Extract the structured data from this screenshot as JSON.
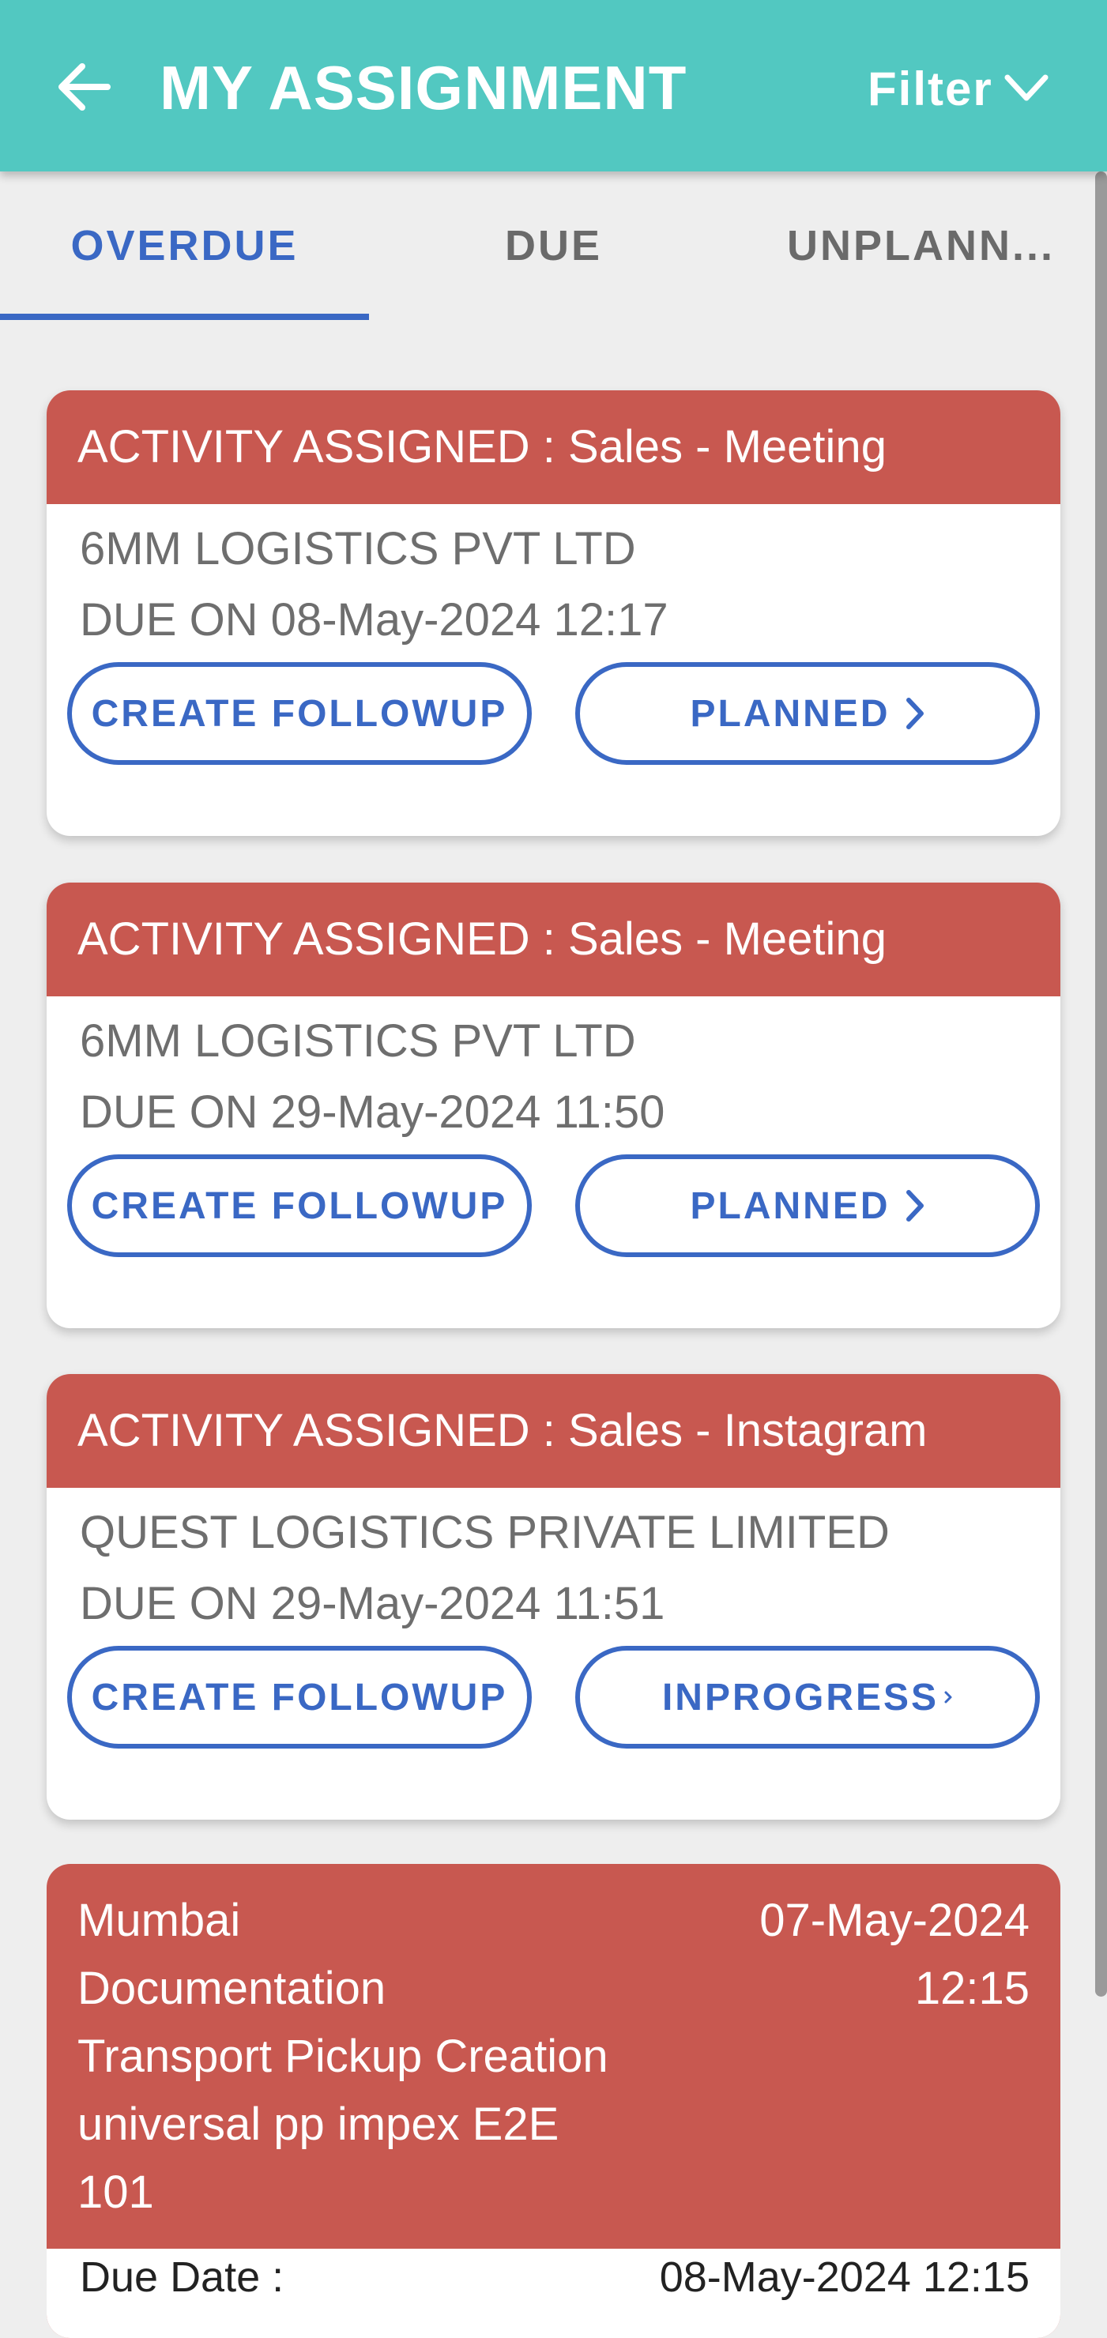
{
  "header": {
    "title": "MY ASSIGNMENT",
    "filter_label": "Filter"
  },
  "tabs": [
    {
      "label": "OVERDUE",
      "active": true
    },
    {
      "label": "DUE",
      "active": false
    },
    {
      "label": "UNPLANN...",
      "active": false
    }
  ],
  "cards": [
    {
      "title": "ACTIVITY ASSIGNED : Sales - Meeting",
      "company": "6MM LOGISTICS PVT LTD",
      "due": "DUE ON 08-May-2024 12:17",
      "left_button": "CREATE FOLLOWUP",
      "right_button": "PLANNED"
    },
    {
      "title": "ACTIVITY ASSIGNED : Sales - Meeting",
      "company": "6MM LOGISTICS PVT LTD",
      "due": "DUE ON 29-May-2024 11:50",
      "left_button": "CREATE FOLLOWUP",
      "right_button": "PLANNED"
    },
    {
      "title": "ACTIVITY ASSIGNED : Sales - Instagram",
      "company": "QUEST LOGISTICS PRIVATE LIMITED",
      "due": "DUE ON 29-May-2024 11:51",
      "left_button": "CREATE FOLLOWUP",
      "right_button": "INPROGRESS"
    }
  ],
  "transport_card": {
    "lines": [
      "Mumbai",
      "Documentation",
      "Transport Pickup Creation",
      "universal pp impex E2E",
      "101"
    ],
    "date": "07-May-2024",
    "time": "12:15",
    "due_label": "Due Date :",
    "due_value": "08-May-2024 12:15"
  },
  "colors": {
    "appbar": "#52c8c1",
    "accent": "#3a68c4",
    "card_header": "#c85850"
  },
  "icons": {
    "back": "back-arrow-icon",
    "filter": "chevron-down-icon",
    "button": "chevron-right-icon"
  }
}
